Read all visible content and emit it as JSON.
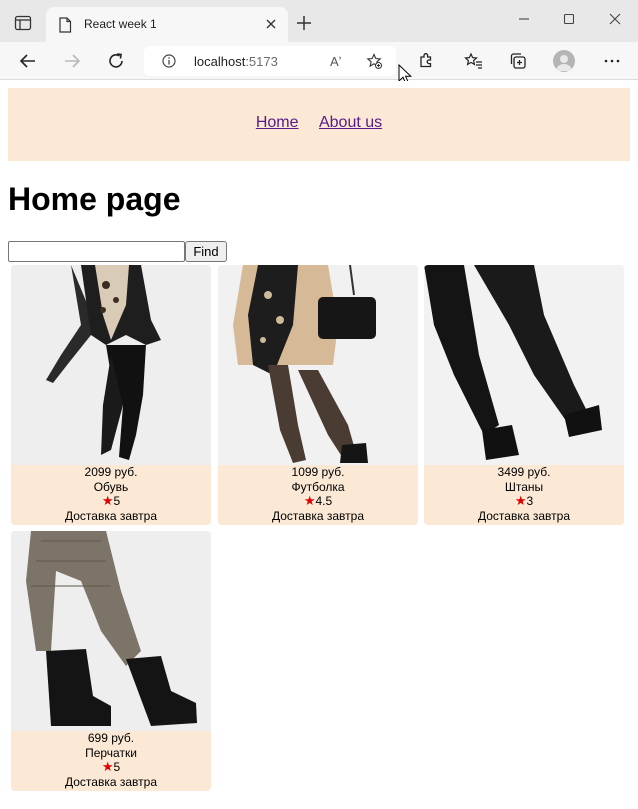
{
  "browser": {
    "tab_title": "React week 1",
    "url_host": "localhost",
    "url_port": ":5173",
    "read_aloud_label": "Aʼ"
  },
  "site": {
    "nav": [
      {
        "label": "Home"
      },
      {
        "label": "About us"
      }
    ],
    "title": "Home page",
    "search": {
      "value": "",
      "placeholder": ""
    },
    "find_label": "Find",
    "colors": {
      "header_bg": "#fbe9d6",
      "card_bg": "#fbe9d6",
      "star": "#e00000",
      "link": "#551a8b"
    }
  },
  "products": [
    {
      "price": "2099 руб.",
      "name": "Обувь",
      "rating": "5",
      "delivery": "Доставка завтра",
      "photo": "woman-leather-jacket-jeans-photo"
    },
    {
      "price": "1099 руб.",
      "name": "Футболка",
      "rating": "4.5",
      "delivery": "Доставка завтра",
      "photo": "woman-trench-coat-handbag-photo"
    },
    {
      "price": "3499 руб.",
      "name": "Штаны",
      "rating": "3",
      "delivery": "Доставка завтра",
      "photo": "black-pants-ankle-boots-photo"
    },
    {
      "price": "699 руб.",
      "name": "Перчатки",
      "rating": "5",
      "delivery": "Доставка завтра",
      "photo": "checked-trousers-black-boots-photo"
    }
  ]
}
